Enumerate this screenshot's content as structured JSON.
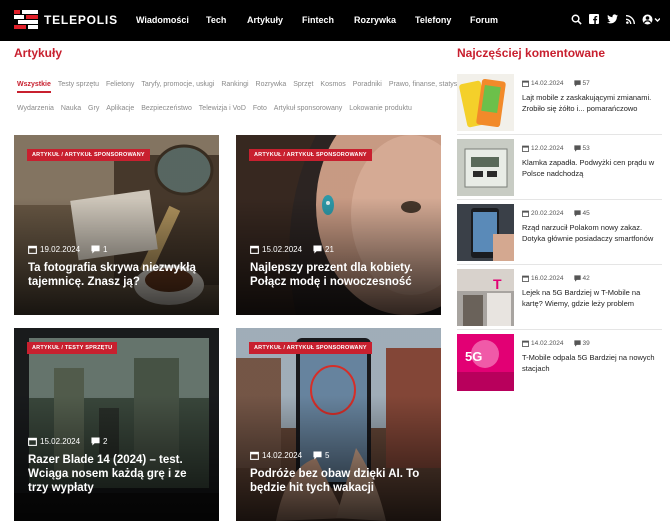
{
  "brand": {
    "name": "TELEPOLIS"
  },
  "nav": {
    "items": [
      "Wiadomości",
      "Tech",
      "Artykuły",
      "Fintech",
      "Rozrywka",
      "Telefony",
      "Forum"
    ]
  },
  "nav_icons": [
    "search-icon",
    "facebook-icon",
    "twitter-icon",
    "rss-icon",
    "user-icon"
  ],
  "main": {
    "title": "Artykuły",
    "filters_row1": [
      "Wszystkie",
      "Testy sprzętu",
      "Felietony",
      "Taryfy, promocje, usługi",
      "Rankingi",
      "Rozrywka",
      "Sprzęt",
      "Kosmos",
      "Poradniki",
      "Prawo, finanse, statystyki"
    ],
    "filters_row2": [
      "Wydarzenia",
      "Nauka",
      "Gry",
      "Aplikacje",
      "Bezpieczeństwo",
      "Telewizja i VoD",
      "Foto",
      "Artykuł sponsorowany",
      "Lokowanie produktu"
    ],
    "cards": [
      {
        "badge": "ARTYKUŁ / ARTYKUŁ SPONSOROWANY",
        "date": "19.02.2024",
        "comments": "1",
        "title": "Ta fotografia skrywa niezwykłą tajemnicę. Znasz ją?"
      },
      {
        "badge": "ARTYKUŁ / ARTYKUŁ SPONSOROWANY",
        "date": "15.02.2024",
        "comments": "21",
        "title": "Najlepszy prezent dla kobiety. Połącz modę i nowoczesność"
      },
      {
        "badge": "ARTYKUŁ / TESTY SPRZĘTU",
        "date": "15.02.2024",
        "comments": "2",
        "title": "Razer Blade 14 (2024) – test. Wciąga nosem każdą grę i ze trzy wypłaty"
      },
      {
        "badge": "ARTYKUŁ / ARTYKUŁ SPONSOROWANY",
        "date": "14.02.2024",
        "comments": "5",
        "title": "Podróże bez obaw dzięki AI. To będzie hit tych wakacji"
      }
    ]
  },
  "sidebar": {
    "title": "Najczęściej komentowane",
    "items": [
      {
        "date": "14.02.2024",
        "comments": "57",
        "title": "Lajt mobile z zaskakującymi zmianami. Zrobiło się żółto i... pomarańczowo"
      },
      {
        "date": "12.02.2024",
        "comments": "53",
        "title": "Klamka zapadła. Podwyżki cen prądu w Polsce nadchodzą"
      },
      {
        "date": "20.02.2024",
        "comments": "45",
        "title": "Rząd narzucił Polakom nowy zakaz. Dotyka głównie posiadaczy smartfonów"
      },
      {
        "date": "16.02.2024",
        "comments": "42",
        "title": "Lejek na 5G Bardziej w T-Mobile na kartę? Wiemy, gdzie leży problem"
      },
      {
        "date": "14.02.2024",
        "comments": "39",
        "title": "T-Mobile odpala 5G Bardziej na nowych stacjach"
      }
    ]
  },
  "colors": {
    "accent": "#c8202f",
    "nav_bg": "#000000"
  }
}
